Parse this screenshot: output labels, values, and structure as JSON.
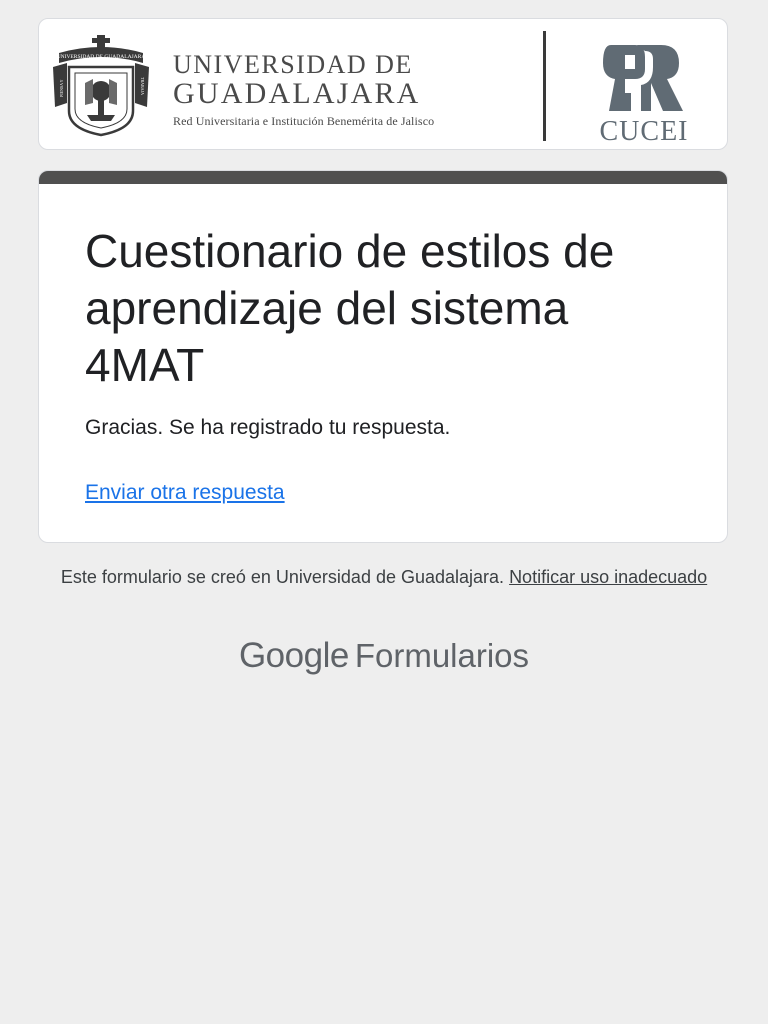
{
  "header": {
    "university_line1": "UNIVERSIDAD DE",
    "university_line2": "GUADALAJARA",
    "tagline": "Red Universitaria e Institución Benemérita de Jalisco",
    "seal_text": "UNIVERSIDAD DE GUADALAJARA",
    "seal_left": "PIENSA Y",
    "seal_right": "TRABAJA",
    "campus_name": "CUCEI"
  },
  "form": {
    "title": "Cuestionario de estilos de aprendizaje del sistema 4MAT",
    "confirmation": "Gracias. Se ha registrado tu respuesta.",
    "submit_another_label": "Enviar otra respuesta"
  },
  "footer": {
    "created_in": "Este formulario se creó en Universidad de Guadalajara.",
    "report_label": "Notificar uso inadecuado",
    "brand_google": "Google",
    "brand_product": "Formularios"
  },
  "colors": {
    "background": "#eeeeee",
    "card_accent": "#505050",
    "link": "#1a73e8"
  }
}
